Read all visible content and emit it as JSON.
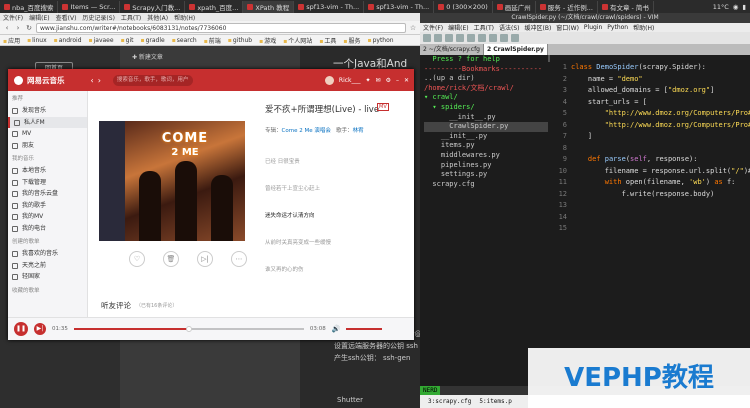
{
  "sysbar": {
    "tabs": [
      "nba_百度搜索",
      "Items — Scr...",
      "Scrapy入门教...",
      "xpath_百度...",
      "XPath 教程",
      "spf13-vim - Th...",
      "spf13-vim - Th...",
      "0 (300×200)",
      "画延广州",
      "服务 - 近作例...",
      "有文章 - 简书"
    ],
    "right": "11°C"
  },
  "browser": {
    "menu": [
      "文件(F)",
      "编辑(E)",
      "查看(V)",
      "历史记录(S)",
      "工具(T)",
      "其他(A)",
      "帮助(H)"
    ],
    "url": "www.jianshu.com/writer#/notebooks/6083131/notes/7736060",
    "bookmarks": [
      "应用",
      "linux",
      "android",
      "javaee",
      "git",
      "gradle",
      "search",
      "前端",
      "github",
      "游戏",
      "个人网站",
      "工具",
      "服务",
      "python"
    ]
  },
  "jianshu": {
    "home": "回首页",
    "new_article": "✚ 新建文章",
    "article_title": "一个Java和And",
    "lines": [
      "登录远端服务器 ssh user@",
      "设置远端服务器的公钥 ssh",
      "产生ssh公钥： ssh-gen"
    ],
    "shutter": "Shutter"
  },
  "netease": {
    "logo": "网易云音乐",
    "search_placeholder": "搜索音乐，歌手，歌词，用户",
    "user": "Rick___",
    "sidebar": [
      {
        "type": "sec",
        "label": "推荐"
      },
      {
        "type": "it",
        "label": "发现音乐"
      },
      {
        "type": "it",
        "label": "私人FM",
        "active": true
      },
      {
        "type": "it",
        "label": "MV"
      },
      {
        "type": "it",
        "label": "朋友"
      },
      {
        "type": "sec",
        "label": "我的音乐"
      },
      {
        "type": "it",
        "label": "本地音乐"
      },
      {
        "type": "it",
        "label": "下载管理"
      },
      {
        "type": "it",
        "label": "我的音乐云盘"
      },
      {
        "type": "it",
        "label": "我的歌手"
      },
      {
        "type": "it",
        "label": "我的MV"
      },
      {
        "type": "it",
        "label": "我的电台"
      },
      {
        "type": "sec",
        "label": "创建的歌单"
      },
      {
        "type": "it",
        "label": "我喜欢的音乐"
      },
      {
        "type": "it",
        "label": "天亮之前"
      },
      {
        "type": "it",
        "label": "轻国家"
      },
      {
        "type": "sec",
        "label": "收藏的歌单"
      }
    ],
    "cover_text": [
      "COME",
      "2 ME"
    ],
    "song_title": "爱不疚+所谓理想(Live) - live",
    "song_tag": "MV",
    "album_label": "专辑：",
    "album": "Come 2 Me 演唱会",
    "singer_label": "歌手：",
    "singer": "林宥",
    "lyrics": [
      "已经 日很宝贵",
      "曾经若干上宣尘心赶上",
      "迷失命运才认清方向",
      "从前时关真亮变成一些缓慢",
      "谁又再的心的伤"
    ],
    "actions": [
      "♡",
      "🗑",
      "▷|",
      "⋯"
    ],
    "comments": "听友评论",
    "comments_sub": "（已有16条评论）",
    "time_current": "01:35",
    "time_total": "03:08",
    "progress": 0.5
  },
  "vim": {
    "title": "CrawlSpider.py (~/文档/crawl/crawl/spiders) - VIM",
    "menu": [
      "文件(F)",
      "编辑(E)",
      "工具(T)",
      "语法(S)",
      "缓冲区(B)",
      "窗口(W)",
      "Plugin",
      "Python",
      "帮助(H)"
    ],
    "tabs": [
      "2 ~/文档/scrapy.cfg",
      "2 CrawlSpider.py"
    ],
    "nerd": [
      [
        "c2",
        "  Press ? for help"
      ],
      [
        "",
        ""
      ],
      [
        "c1",
        "---------Bookmarks----------"
      ],
      [
        "",
        ""
      ],
      [
        "",
        "..(up a dir)"
      ],
      [
        "c1",
        "/home/rick/文档/crawl/"
      ],
      [
        "c2",
        "▾ crawl/"
      ],
      [
        "c2",
        "  ▾ spiders/"
      ],
      [
        "",
        "      __init__.py"
      ],
      [
        "sel",
        "      CrawlSpider.py"
      ],
      [
        "",
        "    __init__.py"
      ],
      [
        "",
        "    items.py"
      ],
      [
        "",
        "    middlewares.py"
      ],
      [
        "",
        "    pipelines.py"
      ],
      [
        "",
        "    settings.py"
      ],
      [
        "",
        "  scrapy.cfg"
      ]
    ],
    "gutter": "1\n2\n3\n4\n5\n6\n7\n8\n9\n10\n11\n12\n13\n14\n15",
    "code": [
      [
        "<span class='k'>class</span> <span class='f'>DemoSpider</span>(scrapy.Spider):"
      ],
      [
        "    name = <span class='s'>\"demo\"</span>"
      ],
      [
        "    allowed_domains = [<span class='s'>\"dmoz.org\"</span>]"
      ],
      [
        "    start_urls = ["
      ],
      [
        "        <span class='s'>\"http://www.dmoz.org/Computers/Pro#</span>"
      ],
      [
        "        <span class='s'>\"http://www.dmoz.org/Computers/Pro#</span>"
      ],
      [
        "    ]"
      ],
      [
        ""
      ],
      [
        "    <span class='k'>def</span> <span class='f'>parse</span>(<span class='n'>self</span>, response):"
      ],
      [
        "        filename = response.url.split(<span class='s'>\"/\"</span>)#"
      ],
      [
        "        <span class='k'>with</span> open(filename, <span class='s'>'wb'</span>) <span class='k'>as</span> f:"
      ],
      [
        "            f.write(response.body)"
      ],
      [
        ""
      ],
      [
        ""
      ],
      [
        ""
      ]
    ],
    "status": "NERD",
    "bottom": [
      "3:scrapy.cfg",
      "5:items.p"
    ]
  },
  "watermark": "VEPHP教程"
}
